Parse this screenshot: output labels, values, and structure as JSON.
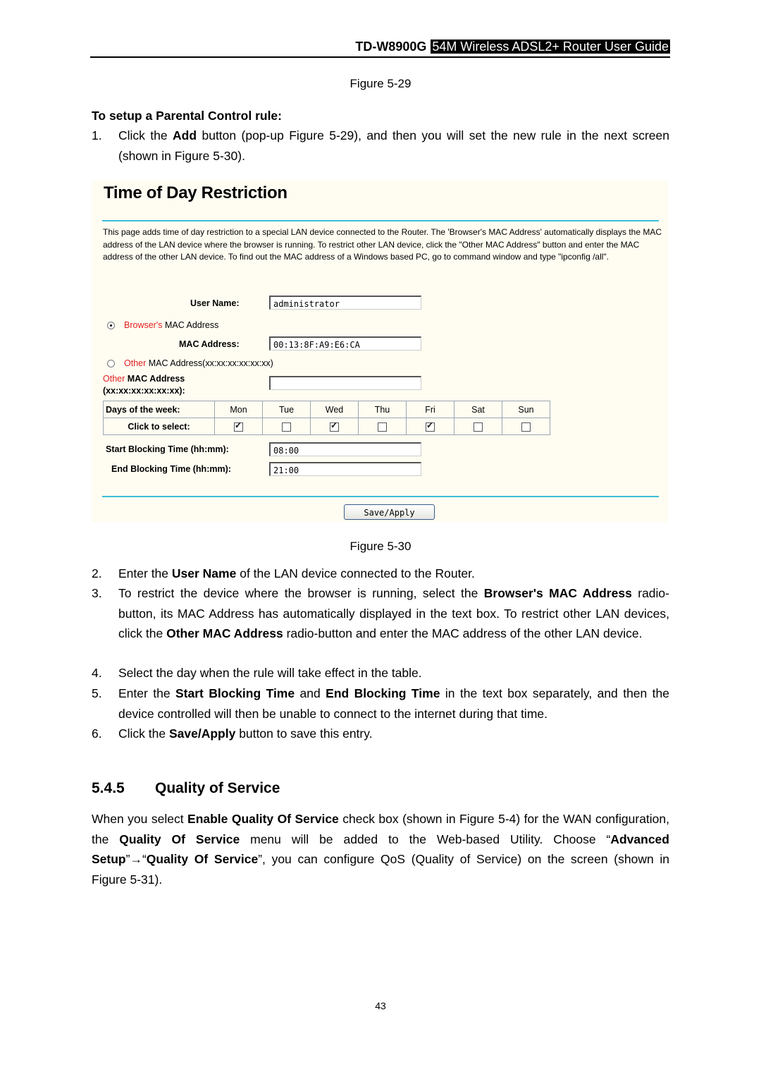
{
  "header": {
    "model": "TD-W8900G",
    "guide_title": "54M Wireless ADSL2+ Router User Guide"
  },
  "figure_top_caption": "Figure 5-29",
  "setup_heading": "To setup a Parental Control rule:",
  "steps": [
    {
      "num": "1.",
      "parts": [
        {
          "t": "Click the "
        },
        {
          "t": "Add",
          "b": true
        },
        {
          "t": " button (pop-up Figure 5-29), and then you will set the new rule in the next screen (shown in Figure 5-30)."
        }
      ]
    },
    {
      "num": "2.",
      "parts": [
        {
          "t": "Enter the "
        },
        {
          "t": "User Name",
          "b": true
        },
        {
          "t": " of the LAN device connected to the Router."
        }
      ]
    },
    {
      "num": "3.",
      "parts": [
        {
          "t": "To restrict the device where the browser is running, select the "
        },
        {
          "t": "Browser's MAC Address",
          "b": true
        },
        {
          "t": " radio-button, its MAC Address has automatically displayed in the text box. To restrict other LAN devices, click the "
        },
        {
          "t": "Other MAC Address",
          "b": true
        },
        {
          "t": " radio-button and enter the MAC address of the other LAN device."
        }
      ]
    },
    {
      "num": "4.",
      "parts": [
        {
          "t": "Select the day when the rule will take effect in the table."
        }
      ]
    },
    {
      "num": "5.",
      "parts": [
        {
          "t": "Enter the "
        },
        {
          "t": "Start Blocking Time",
          "b": true
        },
        {
          "t": " and "
        },
        {
          "t": "End Blocking Time",
          "b": true
        },
        {
          "t": " in the text box separately, and then the device controlled will then be unable to connect to the internet during that time."
        }
      ]
    },
    {
      "num": "6.",
      "parts": [
        {
          "t": "Click the "
        },
        {
          "t": "Save/Apply",
          "b": true
        },
        {
          "t": " button to save this entry."
        }
      ]
    }
  ],
  "screenshot": {
    "title": "Time of Day Restriction",
    "description": "This page adds time of day restriction to a special LAN device connected to the Router. The 'Browser's MAC Address' automatically displays the MAC address of the LAN device where the browser is running. To restrict other LAN device, click the \"Other MAC Address\" button and enter the MAC address of the other LAN device. To find out the MAC address of a Windows based PC, go to command window and type \"ipconfig /all\".",
    "user_name_label": "User Name:",
    "user_name_value": "administrator",
    "browser_mac_radio": {
      "red": "Browser's",
      "rest": " MAC Address",
      "selected": true
    },
    "mac_address_label": "MAC Address:",
    "mac_address_value": "00:13:8F:A9:E6:CA",
    "other_mac_radio": {
      "red": "Other",
      "rest": " MAC Address(xx:xx:xx:xx:xx:xx)",
      "selected": false
    },
    "other_mac_label": {
      "red": "Other",
      "rest": " MAC Address",
      "format": "(xx:xx:xx:xx:xx:xx):"
    },
    "other_mac_value": "",
    "days_label": "Days of the week:",
    "select_label": "Click to select:",
    "days": [
      {
        "name": "Mon",
        "checked": true
      },
      {
        "name": "Tue",
        "checked": false
      },
      {
        "name": "Wed",
        "checked": true
      },
      {
        "name": "Thu",
        "checked": false
      },
      {
        "name": "Fri",
        "checked": true
      },
      {
        "name": "Sat",
        "checked": false
      },
      {
        "name": "Sun",
        "checked": false
      }
    ],
    "start_label": "Start Blocking Time (hh:mm):",
    "start_value": "08:00",
    "end_label": "End Blocking Time (hh:mm):",
    "end_value": "21:00",
    "save_button": "Save/Apply",
    "accent_color": "#3bbcd8"
  },
  "figure_bottom_caption": "Figure 5-30",
  "section": {
    "number": "5.4.5",
    "title": "Quality of Service",
    "paragraph": [
      {
        "t": "When you select "
      },
      {
        "t": "Enable Quality Of Service",
        "b": true
      },
      {
        "t": " check box (shown in Figure 5-4) for the WAN configuration, the "
      },
      {
        "t": "Quality Of Service",
        "b": true
      },
      {
        "t": " menu will be added to the Web-based Utility. Choose “"
      },
      {
        "t": "Advanced Setup",
        "b": true
      },
      {
        "t": "”→“"
      },
      {
        "t": "Quality Of Service",
        "b": true
      },
      {
        "t": "”, you can configure QoS (Quality of Service) on the screen (shown in Figure 5-31)."
      }
    ]
  },
  "page_number": "43"
}
